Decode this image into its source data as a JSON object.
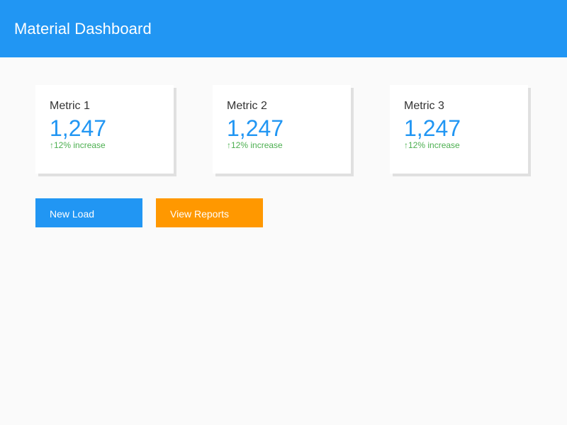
{
  "app_bar": {
    "title": "Material Dashboard",
    "color": "#2196f3"
  },
  "metrics": [
    {
      "label": "Metric 1",
      "value": "1,247",
      "trend": "↑12% increase",
      "trend_icon": "arrow-up-icon"
    },
    {
      "label": "Metric 2",
      "value": "1,247",
      "trend": "↑12% increase",
      "trend_icon": "arrow-up-icon"
    },
    {
      "label": "Metric 3",
      "value": "1,247",
      "trend": "↑12% increase",
      "trend_icon": "arrow-up-icon"
    }
  ],
  "actions": {
    "new_load_label": "New Load",
    "new_load_color": "#2196f3",
    "view_reports_label": "View Reports",
    "view_reports_color": "#ff9800"
  },
  "colors": {
    "trend_positive": "#4caf50",
    "value_accent": "#2196f3",
    "background": "#fafafa"
  }
}
